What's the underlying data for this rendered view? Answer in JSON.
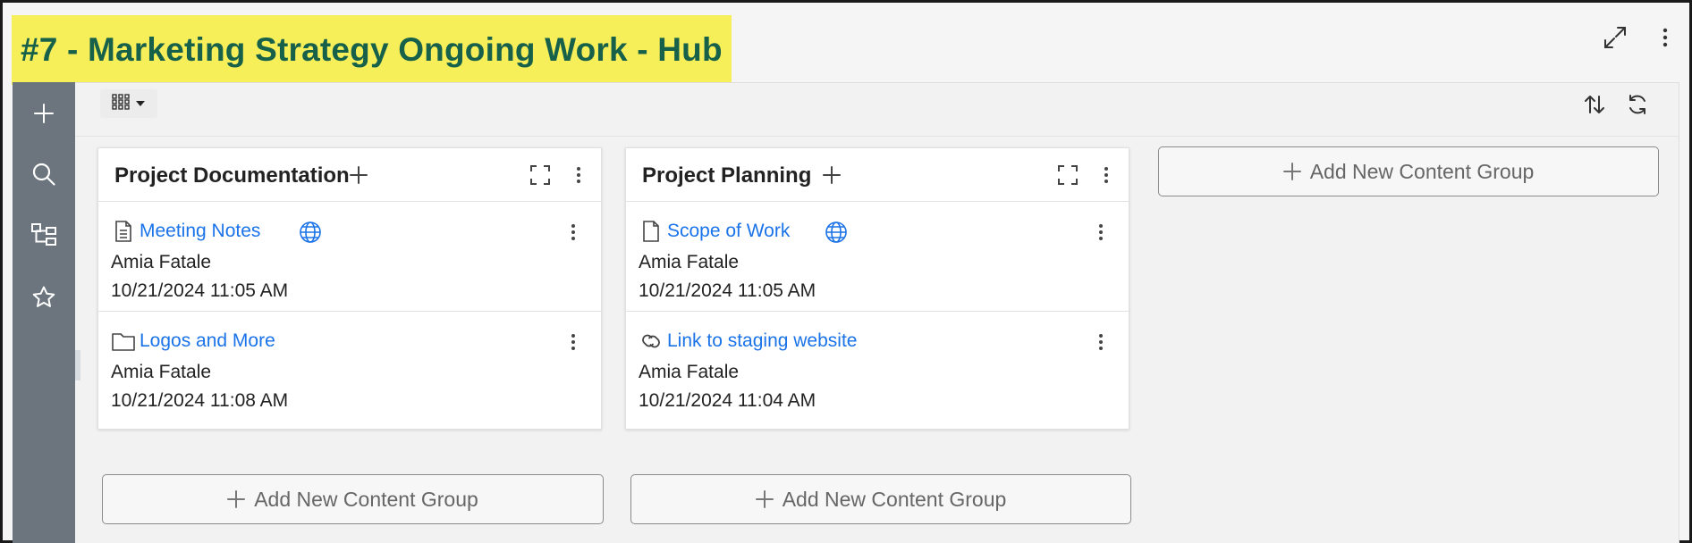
{
  "page": {
    "title": "#7 - Marketing Strategy Ongoing Work - Hub"
  },
  "header": {
    "icons": [
      "expand-icon",
      "more-vertical-icon"
    ]
  },
  "sidebar": {
    "items": [
      {
        "name": "add",
        "icon": "plus-icon"
      },
      {
        "name": "search",
        "icon": "search-icon"
      },
      {
        "name": "tree",
        "icon": "hierarchy-icon"
      },
      {
        "name": "favorites",
        "icon": "star-icon"
      }
    ]
  },
  "toolbar": {
    "view_icon": "grid-icon",
    "sort_icon": "sort-icon",
    "refresh_icon": "refresh-icon"
  },
  "groups": [
    {
      "title": "Project Documentation",
      "items": [
        {
          "type_icon": "document-icon",
          "name": "Meeting Notes",
          "public": true,
          "author": "Amia Fatale",
          "date": "10/21/2024 11:05 AM"
        },
        {
          "type_icon": "folder-icon",
          "name": "Logos and More",
          "public": false,
          "author": "Amia Fatale",
          "date": "10/21/2024 11:08 AM"
        }
      ]
    },
    {
      "title": "Project Planning",
      "items": [
        {
          "type_icon": "file-icon",
          "name": "Scope of Work",
          "public": true,
          "author": "Amia Fatale",
          "date": "10/21/2024 11:05 AM"
        },
        {
          "type_icon": "link-icon",
          "name": "Link to staging website",
          "public": false,
          "author": "Amia Fatale",
          "date": "10/21/2024 11:04 AM"
        }
      ]
    }
  ],
  "add_group_label": "Add New Content Group",
  "colors": {
    "title_highlight": "#f7ef5a",
    "title_text": "#17614a",
    "sidebar": "#6c757d",
    "link": "#1a73e8"
  }
}
